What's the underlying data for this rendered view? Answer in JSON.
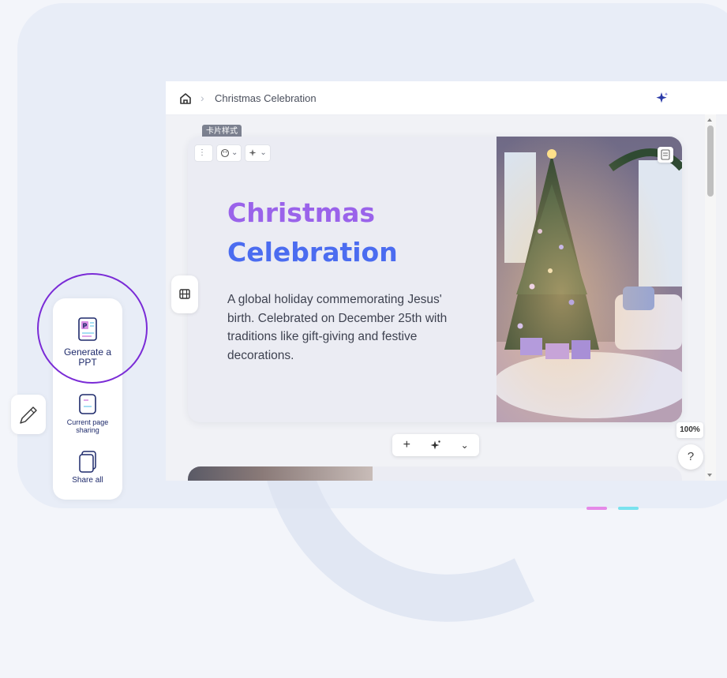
{
  "breadcrumb": {
    "current": "Christmas Celebration"
  },
  "card": {
    "tag": "卡片样式",
    "title_line1": "Christmas",
    "title_line2": "Celebration",
    "description": "A global holiday commemorating Jesus' birth. Celebrated on December 25th with traditions like gift-giving and festive decorations."
  },
  "controls": {
    "zoom": "100%",
    "help": "?"
  },
  "share_panel": {
    "generate_ppt": "Generate a PPT",
    "current_page_sharing": "Current page sharing",
    "share_all": "Share all"
  },
  "colors": {
    "title_purple": "#9a63ea",
    "title_blue": "#4b6cf0",
    "focus_ring": "#7a2bd6",
    "panel_text": "#1e2a6b"
  },
  "icons": [
    "home-icon",
    "chevron-right-icon",
    "sparkle-icon",
    "more-vertical-icon",
    "palette-icon",
    "magic-icon",
    "notes-icon",
    "filmstrip-icon",
    "plus-icon",
    "chevron-down-icon",
    "pen-icon",
    "ppt-icon",
    "page-icon",
    "pages-icon"
  ]
}
